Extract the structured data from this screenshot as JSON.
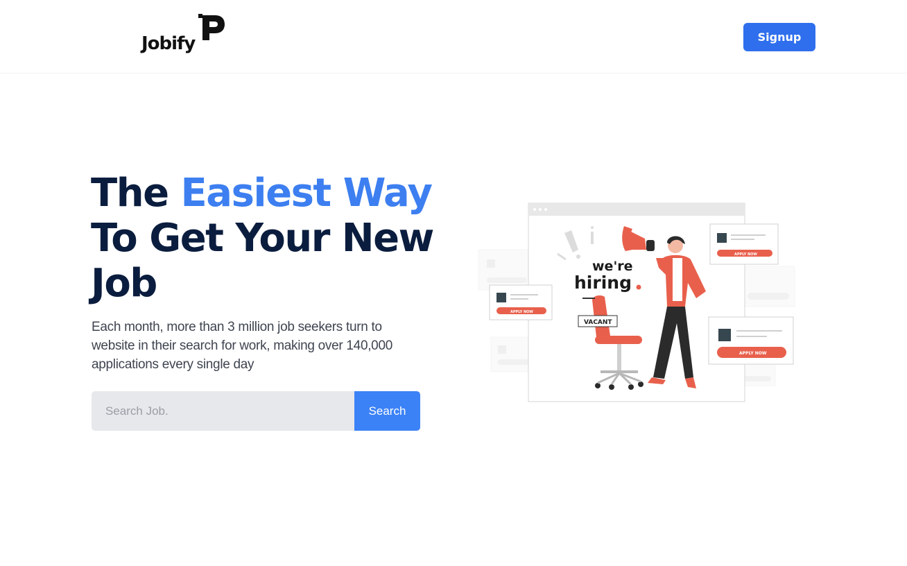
{
  "nav": {
    "logo_text": "Jobify",
    "signup_label": "Signup"
  },
  "hero": {
    "title_part1": "The ",
    "title_accent": "Easiest Way",
    "title_part2": "To Get Your New Job",
    "subtitle": "Each month, more than 3 million job seekers turn to website in their search for work, making over 140,000 applications every single day"
  },
  "search": {
    "placeholder": "Search Job.",
    "value": "",
    "button_label": "Search"
  },
  "illustration": {
    "headline_line1": "we're",
    "headline_line2": "hiring",
    "vacant_sign": "VACANT",
    "apply_label": "APPLY NOW"
  },
  "colors": {
    "accent": "#3d7ff0",
    "button": "#2f6fed",
    "heading": "#0b1d3e",
    "illustration_red": "#e8604c"
  }
}
